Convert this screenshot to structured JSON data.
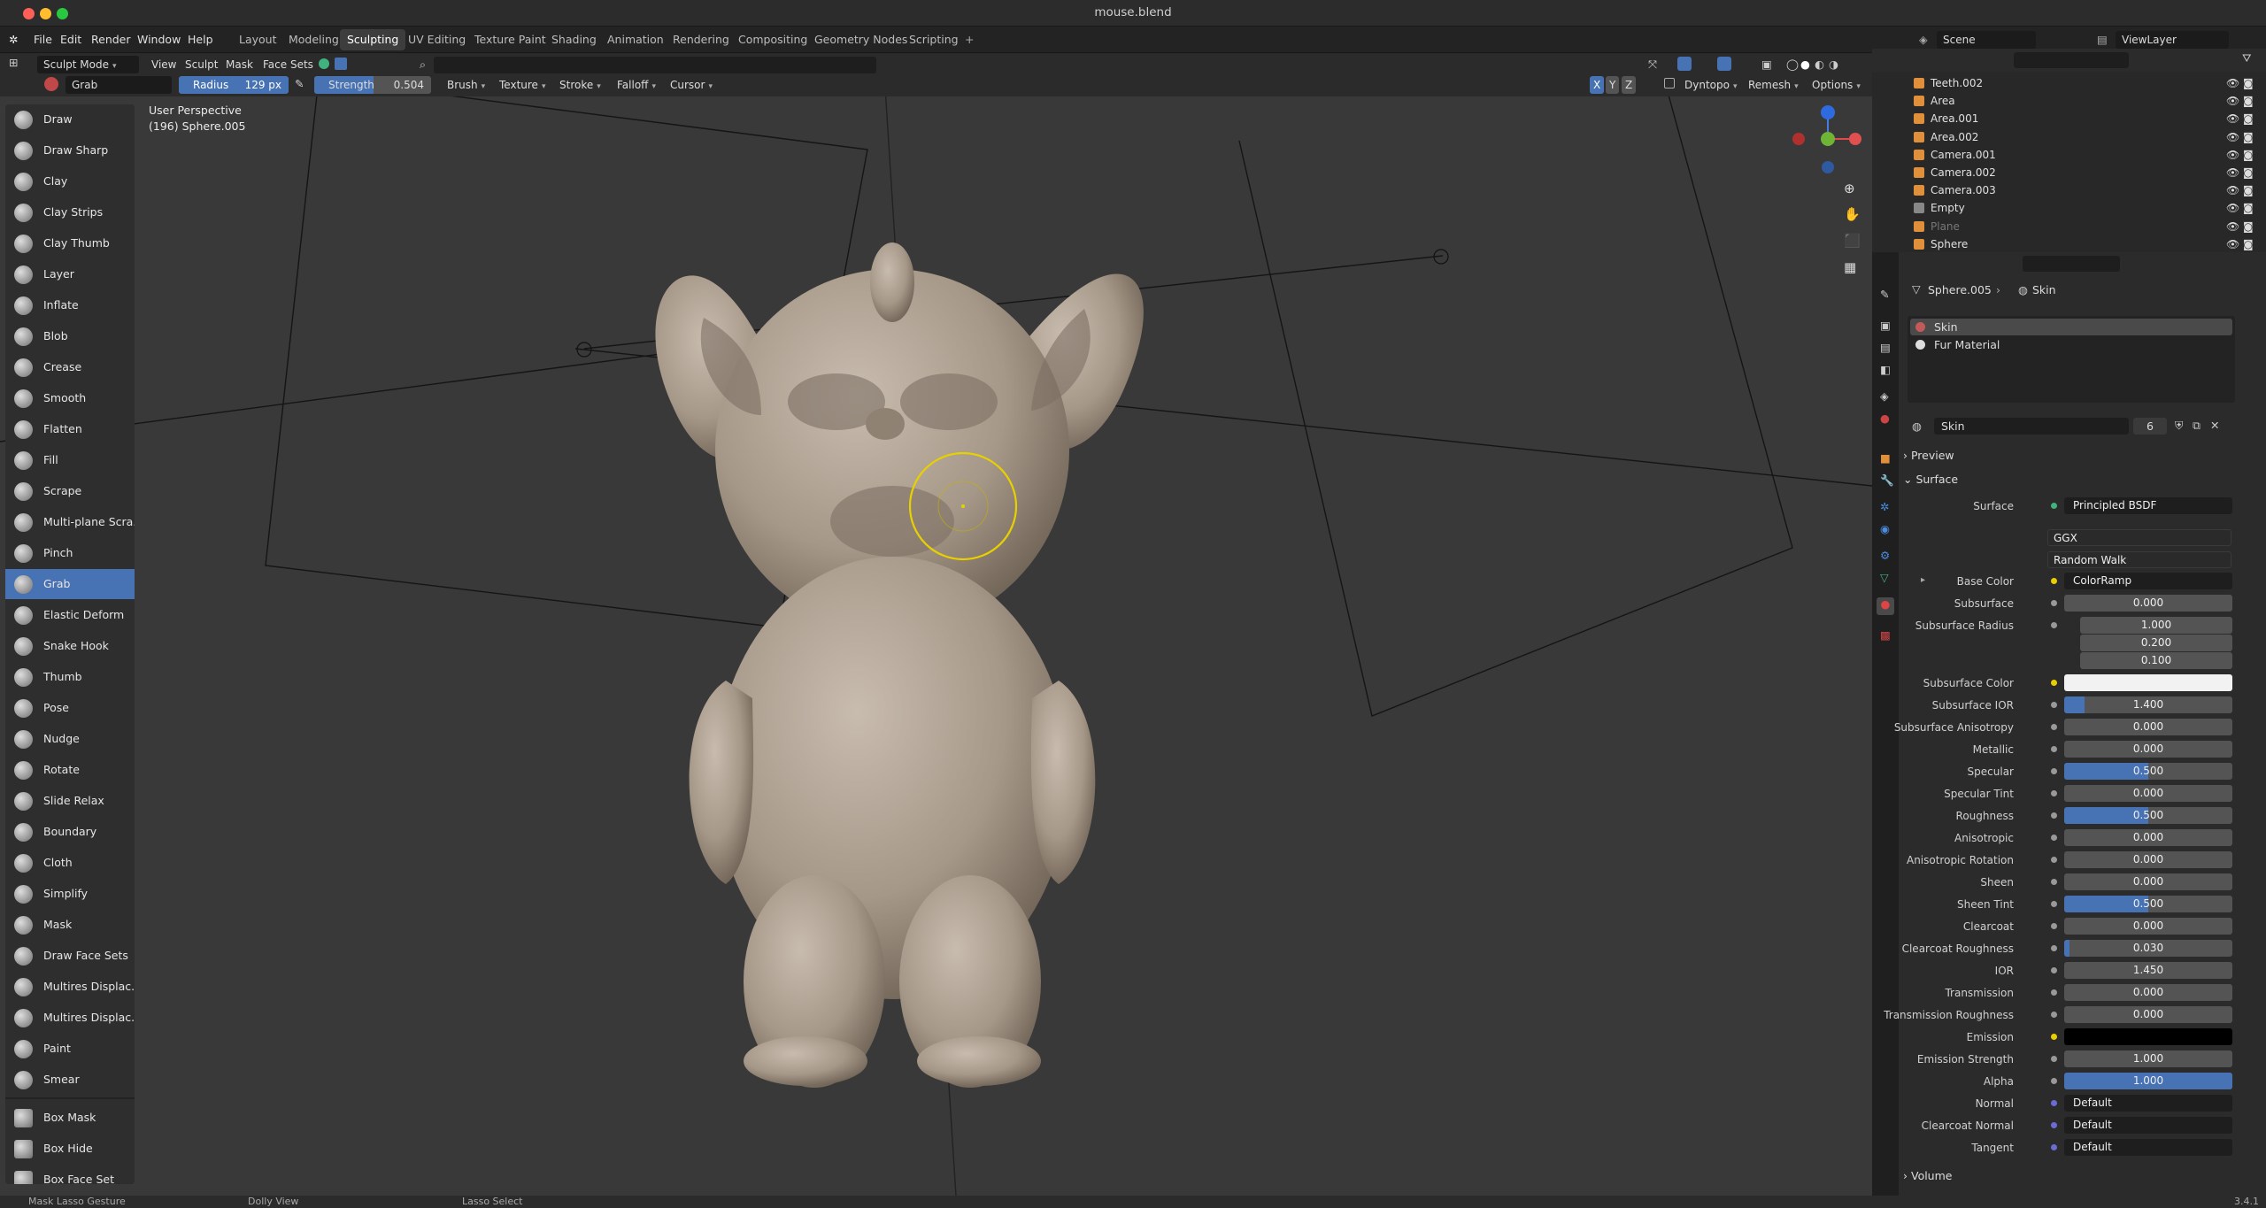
{
  "window": {
    "title": "mouse.blend"
  },
  "menu": {
    "items": [
      "File",
      "Edit",
      "Render",
      "Window",
      "Help"
    ]
  },
  "workspaces": [
    "Layout",
    "Modeling",
    "Sculpting",
    "UV Editing",
    "Texture Paint",
    "Shading",
    "Animation",
    "Rendering",
    "Compositing",
    "Geometry Nodes",
    "Scripting"
  ],
  "scene": {
    "name": "Scene",
    "view_layer": "ViewLayer"
  },
  "header": {
    "mode": "Sculpt Mode",
    "menus": [
      "View",
      "Sculpt",
      "Mask",
      "Face Sets"
    ],
    "brush_name": "Grab",
    "radius_label": "Radius",
    "radius_value": "129 px",
    "strength_label": "Strength",
    "strength_value": "0.504",
    "strength_fraction": 0.504,
    "dropdowns": [
      "Brush",
      "Texture",
      "Stroke",
      "Falloff",
      "Cursor"
    ],
    "right_items": [
      "Dyntopo",
      "Remesh",
      "Options"
    ],
    "axes": [
      "X",
      "Y",
      "Z"
    ]
  },
  "viewport": {
    "perspective": "User Perspective",
    "object": "(196) Sphere.005"
  },
  "tools": [
    "Draw",
    "Draw Sharp",
    "Clay",
    "Clay Strips",
    "Clay Thumb",
    "Layer",
    "Inflate",
    "Blob",
    "Crease",
    "Smooth",
    "Flatten",
    "Fill",
    "Scrape",
    "Multi-plane Scra...",
    "Pinch",
    "Grab",
    "Elastic Deform",
    "Snake Hook",
    "Thumb",
    "Pose",
    "Nudge",
    "Rotate",
    "Slide Relax",
    "Boundary",
    "Cloth",
    "Simplify",
    "Mask",
    "Draw Face Sets",
    "Multires Displac...",
    "Multires Displac...",
    "Paint",
    "Smear"
  ],
  "tools_selected": "Grab",
  "tools_extra": [
    "Box Mask",
    "Box Hide",
    "Box Face Set"
  ],
  "outliner": [
    "Teeth.002",
    "Area",
    "Area.001",
    "Area.002",
    "Camera.001",
    "Camera.002",
    "Camera.003",
    "Empty",
    "Plane",
    "Sphere"
  ],
  "properties": {
    "breadcrumb": [
      "Sphere.005",
      "Skin"
    ],
    "material_slots": [
      "Skin",
      "Fur Material"
    ],
    "material_name": "Skin",
    "users": "6",
    "sections": [
      "Preview",
      "Surface",
      "Volume"
    ],
    "surface_shader": "Principled BSDF",
    "distribution": "GGX",
    "subsurface_method": "Random Walk",
    "base_color": "ColorRamp",
    "rows": [
      {
        "label": "Subsurface",
        "value": "0.000",
        "fill": 0
      },
      {
        "label": "Subsurface Radius",
        "value": "1.000",
        "fill": 0
      },
      {
        "label": "",
        "value": "0.200",
        "fill": 0
      },
      {
        "label": "",
        "value": "0.100",
        "fill": 0
      },
      {
        "label": "Subsurface Color",
        "value": "",
        "fill": 0,
        "color": "#f2f2f2"
      },
      {
        "label": "Subsurface IOR",
        "value": "1.400",
        "fill": 0.12
      },
      {
        "label": "Subsurface Anisotropy",
        "value": "0.000",
        "fill": 0
      },
      {
        "label": "Metallic",
        "value": "0.000",
        "fill": 0
      },
      {
        "label": "Specular",
        "value": "0.500",
        "fill": 0.5
      },
      {
        "label": "Specular Tint",
        "value": "0.000",
        "fill": 0
      },
      {
        "label": "Roughness",
        "value": "0.500",
        "fill": 0.5
      },
      {
        "label": "Anisotropic",
        "value": "0.000",
        "fill": 0
      },
      {
        "label": "Anisotropic Rotation",
        "value": "0.000",
        "fill": 0
      },
      {
        "label": "Sheen",
        "value": "0.000",
        "fill": 0
      },
      {
        "label": "Sheen Tint",
        "value": "0.500",
        "fill": 0.5
      },
      {
        "label": "Clearcoat",
        "value": "0.000",
        "fill": 0
      },
      {
        "label": "Clearcoat Roughness",
        "value": "0.030",
        "fill": 0.03
      },
      {
        "label": "IOR",
        "value": "1.450",
        "fill": 0
      },
      {
        "label": "Transmission",
        "value": "0.000",
        "fill": 0
      },
      {
        "label": "Transmission Roughness",
        "value": "0.000",
        "fill": 0
      },
      {
        "label": "Emission",
        "value": "",
        "fill": 0,
        "color": "#000000"
      },
      {
        "label": "Emission Strength",
        "value": "1.000",
        "fill": 0
      },
      {
        "label": "Alpha",
        "value": "1.000",
        "fill": 1
      },
      {
        "label": "Normal",
        "value": "Default",
        "fill": 0,
        "dark": true
      },
      {
        "label": "Clearcoat Normal",
        "value": "Default",
        "fill": 0,
        "dark": true
      },
      {
        "label": "Tangent",
        "value": "Default",
        "fill": 0,
        "dark": true
      }
    ],
    "surface_label": "Surface",
    "base_color_label": "Base Color"
  },
  "status": {
    "items": [
      "Mask Lasso Gesture",
      "Dolly View",
      "Lasso Select"
    ],
    "version": "3.4.1"
  },
  "colors": {
    "accent": "#4772b3",
    "brush_circle": "#e8d000",
    "model": "#a89a8b"
  }
}
